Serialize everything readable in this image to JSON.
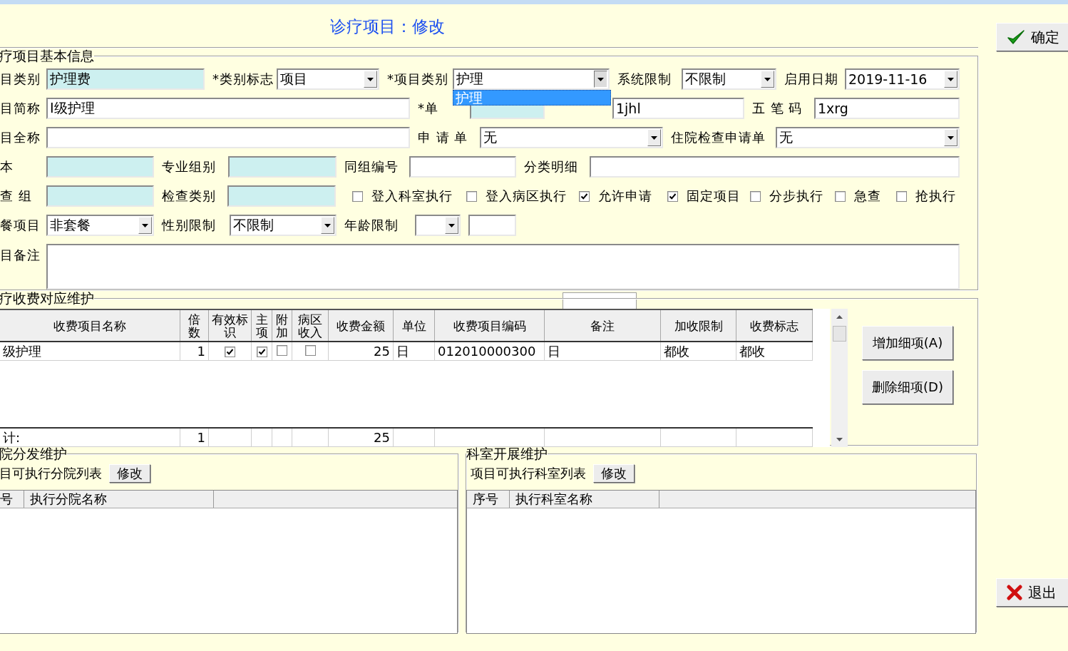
{
  "window": {
    "title": "诊疗项目：修改"
  },
  "basic_info": {
    "legend": "疗项目基本信息",
    "rows": [
      {
        "fields": [
          {
            "kind": "text",
            "label": "目类别",
            "value": "护理费",
            "readonly": true
          },
          {
            "kind": "combo",
            "label": "*类别标志",
            "value": "项目",
            "expanded": false
          },
          {
            "kind": "combo",
            "label": "*项目类别",
            "value": "护理",
            "expanded": true,
            "options": [
              {
                "label": "护理",
                "selected": true
              }
            ]
          },
          {
            "kind": "combo",
            "label": "系统限制",
            "value": "不限制",
            "expanded": false
          },
          {
            "kind": "combo",
            "label": "启用日期",
            "value": "2019-11-16",
            "expanded": false
          }
        ]
      },
      {
        "fields": [
          {
            "kind": "text",
            "label": "目简称",
            "value": "Ⅰ级护理",
            "readonly": false
          },
          {
            "kind": "text",
            "label": "*单",
            "readonly": true
          },
          {
            "kind": "text",
            "value": "1jhl",
            "readonly": false
          },
          {
            "kind": "text",
            "label": "五 笔 码",
            "value": "1xrg",
            "readonly": false
          }
        ]
      },
      {
        "fields": [
          {
            "kind": "text",
            "label": "目全称",
            "readonly": false
          },
          {
            "kind": "combo",
            "label": "申 请 单",
            "value": "无",
            "expanded": false
          },
          {
            "kind": "combo",
            "label": "住院检查申请单",
            "value": "无",
            "expanded": false
          }
        ]
      },
      {
        "fields": [
          {
            "kind": "text",
            "label": "本",
            "readonly": true
          },
          {
            "kind": "text",
            "label": "专业组别",
            "readonly": true
          },
          {
            "kind": "text",
            "label": "同组编号",
            "readonly": false
          },
          {
            "kind": "text",
            "label": "分类明细",
            "readonly": false
          }
        ]
      },
      {
        "fields": [
          {
            "kind": "text",
            "label": "查 组",
            "readonly": true
          },
          {
            "kind": "text",
            "label": "检查类别",
            "readonly": true
          },
          {
            "kind": "check",
            "label": "登入科室执行",
            "checked": false
          },
          {
            "kind": "check",
            "label": "登入病区执行",
            "checked": false
          },
          {
            "kind": "check",
            "label": "允许申请",
            "checked": true
          },
          {
            "kind": "check",
            "label": "固定项目",
            "checked": true
          },
          {
            "kind": "check",
            "label": "分步执行",
            "checked": false
          },
          {
            "kind": "check",
            "label": "急查",
            "checked": false
          },
          {
            "kind": "check",
            "label": "抢执行",
            "checked": false
          }
        ]
      },
      {
        "fields": [
          {
            "kind": "combo",
            "label": "餐项目",
            "value": "非套餐",
            "expanded": false
          },
          {
            "kind": "combo",
            "label": "性别限制",
            "value": "不限制",
            "expanded": false
          },
          {
            "kind": "combo",
            "label": "年龄限制",
            "expanded": false
          },
          {
            "kind": "text",
            "readonly": false
          }
        ]
      },
      {
        "fields": [
          {
            "kind": "textarea",
            "label": "目备注"
          }
        ]
      }
    ]
  },
  "charges": {
    "legend": "疗收费对应维护",
    "columns": [
      {
        "label": "收费项目名称",
        "kind": "text"
      },
      {
        "label": "倍数",
        "kind": "number"
      },
      {
        "label": "有效标识",
        "kind": "check"
      },
      {
        "label": "主项",
        "kind": "check"
      },
      {
        "label": "附加",
        "kind": "check"
      },
      {
        "label": "病区收入",
        "kind": "check"
      },
      {
        "label": "收费金额",
        "kind": "number"
      },
      {
        "label": "单位",
        "kind": "text"
      },
      {
        "label": "收费项目编码",
        "kind": "text"
      },
      {
        "label": "备注",
        "kind": "text"
      },
      {
        "label": "加收限制",
        "kind": "text"
      },
      {
        "label": "收费标志",
        "kind": "text"
      }
    ],
    "rows": [
      {
        "cells": [
          {
            "text": "级护理"
          },
          {
            "text": "1"
          },
          {
            "checked": true
          },
          {
            "checked": true
          },
          {
            "checked": false
          },
          {
            "checked": false
          },
          {
            "text": "25"
          },
          {
            "text": "日"
          },
          {
            "text": "012010000300"
          },
          {
            "text": "日"
          },
          {
            "text": "都收"
          },
          {
            "text": "都收"
          }
        ]
      }
    ],
    "total": {
      "name": "计:",
      "count": "1",
      "amount": "25"
    },
    "buttons": [
      "增加细项(A)",
      "删除细项(D)"
    ]
  },
  "branches": {
    "legend": "院分发维护",
    "caption": "目可执行分院列表",
    "button": "修改",
    "columns": [
      "号",
      "执行分院名称"
    ]
  },
  "departments": {
    "legend": "科室开展维护",
    "caption": "项目可执行科室列表",
    "button": "修改",
    "columns": [
      "序号",
      "执行科室名称"
    ]
  },
  "actions": [
    {
      "label": "确定",
      "kind": "confirm"
    },
    {
      "label": "退出",
      "kind": "exit"
    }
  ]
}
